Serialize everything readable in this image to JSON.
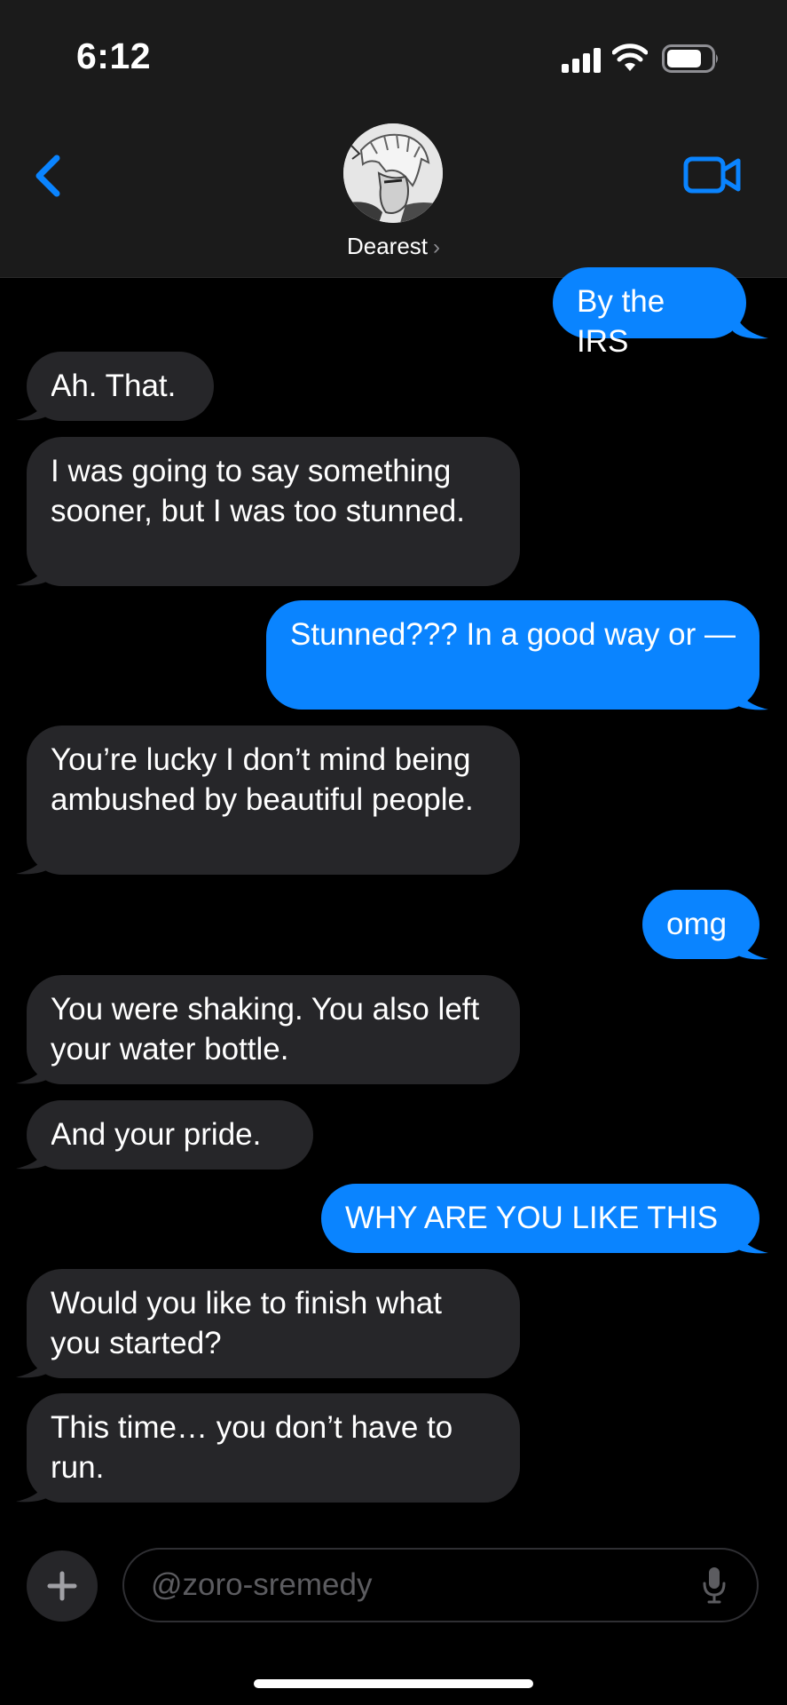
{
  "status_bar": {
    "time": "6:12"
  },
  "header": {
    "contact_name": "Dearest",
    "chevron": "›"
  },
  "messages": [
    {
      "direction": "out",
      "text": "By the IRS"
    },
    {
      "direction": "in",
      "text": "Ah. That."
    },
    {
      "direction": "in",
      "text": "I was going to say something sooner, but I was too stunned."
    },
    {
      "direction": "out",
      "text": "Stunned??? In a good way or —"
    },
    {
      "direction": "in",
      "text": "You’re lucky I don’t mind being ambushed by beautiful people."
    },
    {
      "direction": "out",
      "text": "omg"
    },
    {
      "direction": "in",
      "text": "You were shaking. You also left your water bottle."
    },
    {
      "direction": "in",
      "text": "And your pride."
    },
    {
      "direction": "out",
      "text": "WHY ARE YOU LIKE THIS"
    },
    {
      "direction": "in",
      "text": "Would you like to finish what you started?"
    },
    {
      "direction": "in",
      "text": "This time… you don’t have to run."
    }
  ],
  "input": {
    "placeholder": "@zoro-sremedy"
  },
  "icons": {
    "back": "chevron-left-icon",
    "video": "video-camera-icon",
    "plus": "plus-icon",
    "mic": "microphone-icon"
  },
  "colors": {
    "outgoing_bubble": "#0a84ff",
    "incoming_bubble": "#262629",
    "accent": "#0a84ff",
    "header_bg": "#1b1b1b"
  }
}
